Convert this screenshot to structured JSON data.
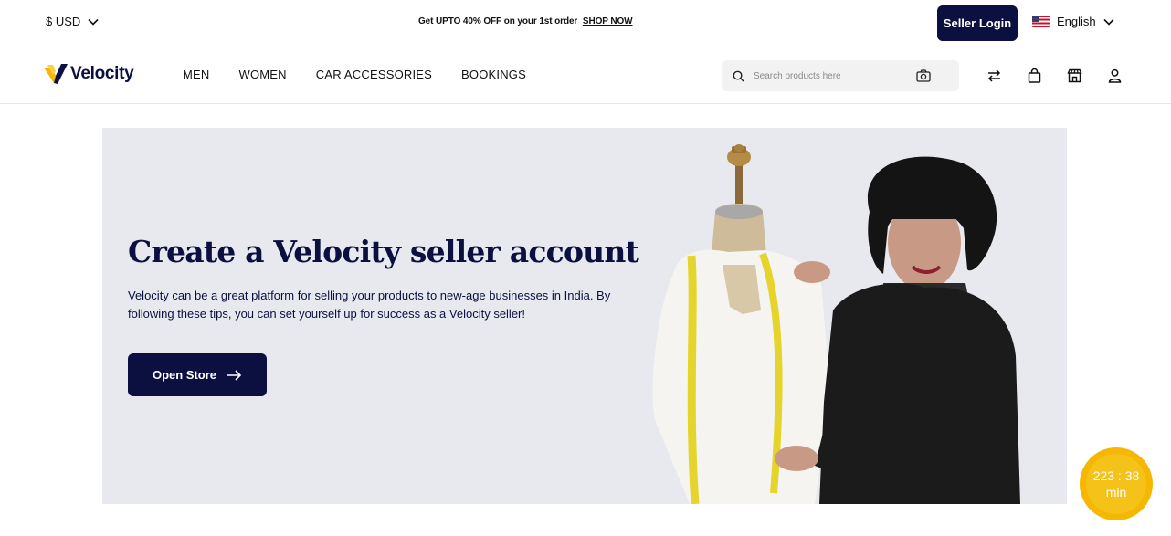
{
  "topbar": {
    "currency": "$ USD",
    "promo_text": "Get UPTO 40% OFF on your 1st order",
    "promo_link": "SHOP NOW",
    "seller_login": "Seller Login",
    "language": "English"
  },
  "nav": {
    "brand": "Velocity",
    "links": [
      "MEN",
      "WOMEN",
      "CAR ACCESSORIES",
      "BOOKINGS"
    ],
    "search_placeholder": "Search products here",
    "icons": [
      "compare-icon",
      "bag-icon",
      "store-icon",
      "user-icon"
    ]
  },
  "hero": {
    "title": "Create a Velocity seller account",
    "description": "Velocity can be a great platform for selling your products to new-age businesses in India. By following these tips, you can set yourself up for success as a Velocity seller!",
    "button": "Open Store"
  },
  "timer": {
    "time": "223 : 38",
    "unit": "min"
  },
  "colors": {
    "brand_navy": "#0b1040",
    "brand_yellow": "#f5b700",
    "hero_bg": "#e7e9ee"
  }
}
